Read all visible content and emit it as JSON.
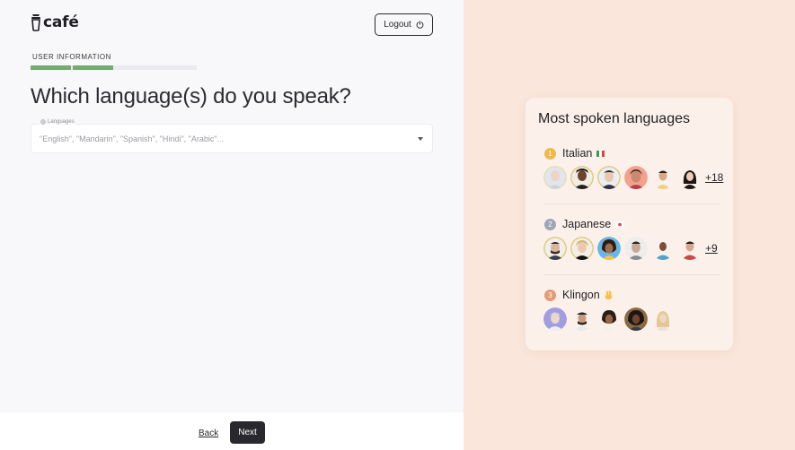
{
  "app": {
    "logo_text": "café"
  },
  "header": {
    "logout_label": "Logout"
  },
  "step": {
    "section_label": "USER INFORMATION",
    "progress_segments_filled": 2,
    "progress_segments_total": 4
  },
  "form": {
    "question": "Which language(s) do you speak?",
    "languages_label": "Languages",
    "languages_placeholder": "\"English\", \"Mandarin\", \"Spanish\", \"Hindi\", \"Arabic\"..."
  },
  "footer": {
    "back_label": "Back",
    "next_label": "Next"
  },
  "card": {
    "title": "Most spoken languages",
    "languages": [
      {
        "rank": "1",
        "name": "Italian",
        "flag": "italy-flag-icon",
        "more": "+18",
        "rank_color": "#f0b84b"
      },
      {
        "rank": "2",
        "name": "Japanese",
        "flag": "japan-flag-icon",
        "more": "+9",
        "rank_color": "#9ea6b6"
      },
      {
        "rank": "3",
        "name": "Klingon",
        "flag": "vulcan-hand-icon",
        "more": "",
        "rank_color": "#e49a74"
      }
    ]
  },
  "colors": {
    "progress": "#74ab6f",
    "accent_dark": "#28282e",
    "panel_bg": "#fbe6db",
    "card_bg": "#fcf1ea"
  }
}
